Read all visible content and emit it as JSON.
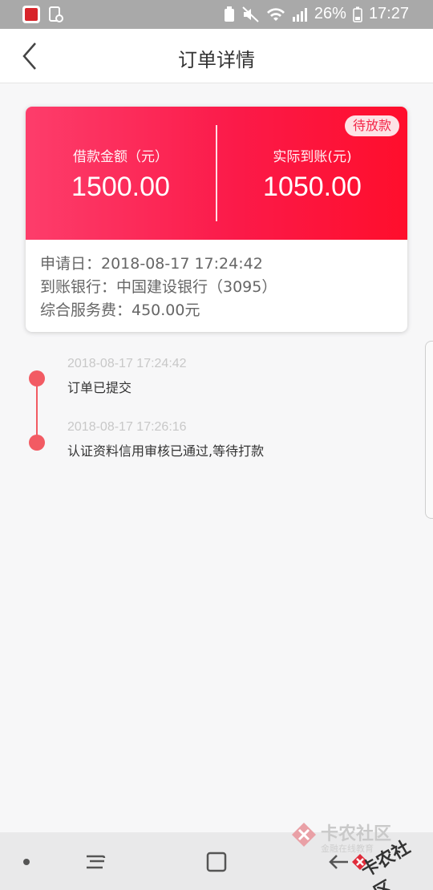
{
  "status_bar": {
    "battery": "26%",
    "time": "17:27"
  },
  "nav": {
    "title": "订单详情"
  },
  "card": {
    "badge": "待放款",
    "loan_label": "借款金额（元）",
    "loan_amount": "1500.00",
    "received_label": "实际到账(元)",
    "received_amount": "1050.00",
    "apply_date": "申请日：2018-08-17 17:24:42",
    "bank": "到账银行：中国建设银行（3095）",
    "fee": "综合服务费：450.00元"
  },
  "timeline": [
    {
      "time": "2018-08-17 17:24:42",
      "text": "订单已提交"
    },
    {
      "time": "2018-08-17 17:26:16",
      "text": "认证资料信用审核已通过,等待打款"
    }
  ],
  "watermark": {
    "main": "卡农社区",
    "sub": "金融在线教育",
    "overlay": "卡农社区"
  },
  "colors": {
    "accent": "#fb1a49",
    "timeline": "#f25b63",
    "badge_bg": "#fde3e6"
  }
}
